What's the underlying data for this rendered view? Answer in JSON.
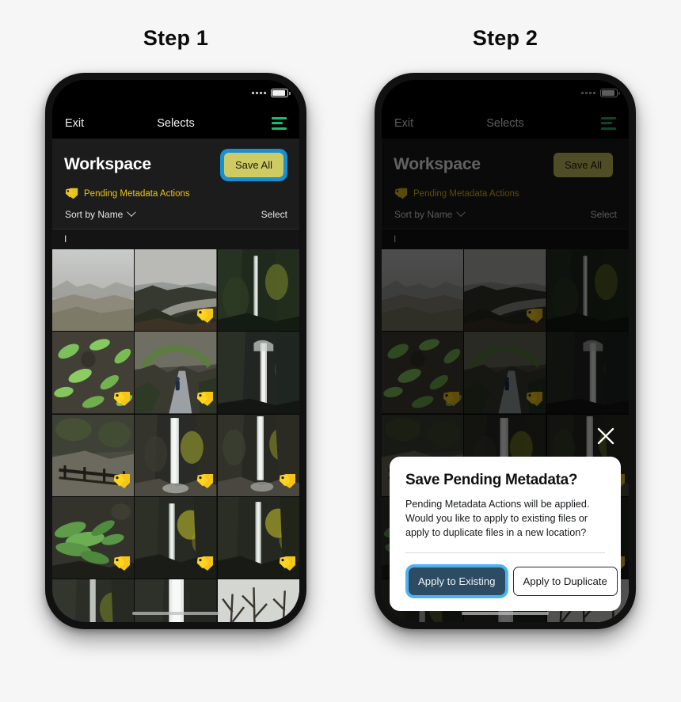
{
  "steps": [
    {
      "label": "Step 1"
    },
    {
      "label": "Step 2"
    }
  ],
  "colors": {
    "accent_green": "#15c06a",
    "tag_yellow": "#e8c31f",
    "save_all_bg": "#cfcb63",
    "focus_blue": "#1a8fd0",
    "modal_primary": "#2d4c63",
    "modal_focus_blue": "#4cb3ef",
    "screen_bg": "#000000",
    "header_bg": "#1c1c1c"
  },
  "phone": {
    "statusbar": {
      "signal_icon": "signal-dots-icon",
      "battery_icon": "battery-icon",
      "battery_level": "92%"
    },
    "navbar": {
      "exit_label": "Exit",
      "title": "Selects",
      "menu_icon": "hamburger-menu-icon"
    },
    "header": {
      "workspace_title": "Workspace",
      "save_all_label": "Save All",
      "pending_icon": "tag-icon",
      "pending_label": "Pending Metadata Actions",
      "sort_label": "Sort by Name",
      "sort_chevron_icon": "chevron-down-icon",
      "select_label": "Select"
    },
    "section_header": "I",
    "grid": {
      "columns": 3,
      "tag_badge_icon": "tag-badge-icon",
      "items": [
        {
          "name": "foggy-gorge-vista",
          "tagged": false
        },
        {
          "name": "coastal-highway-overlook",
          "tagged": true
        },
        {
          "name": "forest-waterfall-tall",
          "tagged": false
        },
        {
          "name": "green-ferns-on-rock",
          "tagged": true
        },
        {
          "name": "hiker-on-mossy-trail",
          "tagged": true
        },
        {
          "name": "waterfall-in-canyon",
          "tagged": false
        },
        {
          "name": "wooden-footbridge",
          "tagged": true
        },
        {
          "name": "latourell-falls",
          "tagged": true
        },
        {
          "name": "elowah-falls",
          "tagged": true
        },
        {
          "name": "fern-wall-closeup",
          "tagged": true
        },
        {
          "name": "autumn-waterfall-left",
          "tagged": true
        },
        {
          "name": "autumn-waterfall-right",
          "tagged": true
        },
        {
          "name": "mossy-falls-partial",
          "tagged": false
        },
        {
          "name": "white-cascade-partial",
          "tagged": false
        },
        {
          "name": "bare-trees-partial",
          "tagged": false
        }
      ]
    },
    "home_indicator": "home-indicator"
  },
  "modal": {
    "close_icon": "close-icon",
    "title": "Save Pending Metadata?",
    "body": "Pending Metadata Actions will be applied. Would you like to apply to existing files or apply to duplicate files in a new location?",
    "primary_button": "Apply to Existing",
    "secondary_button": "Apply to Duplicate"
  }
}
